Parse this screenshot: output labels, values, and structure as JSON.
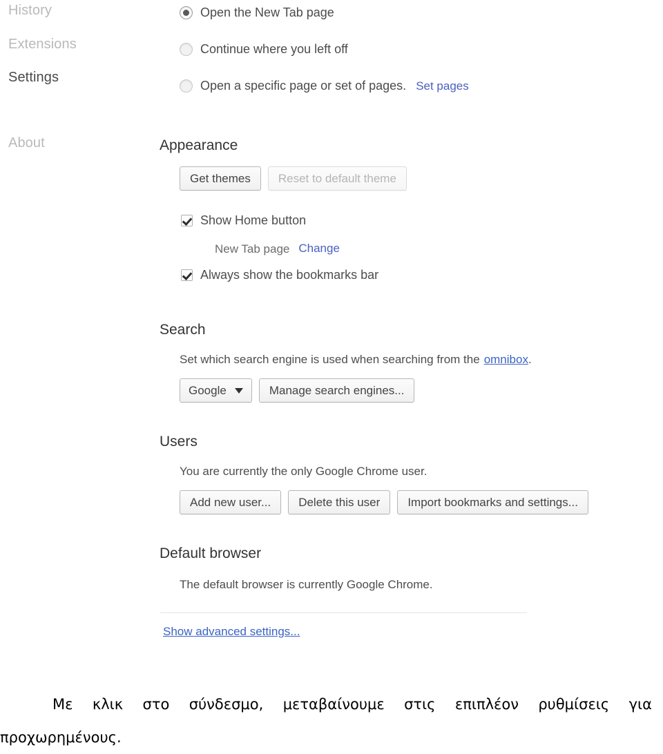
{
  "sidebar": {
    "items": [
      {
        "label": "History",
        "active": false
      },
      {
        "label": "Extensions",
        "active": false
      },
      {
        "label": "Settings",
        "active": true
      },
      {
        "label": "About",
        "active": false
      }
    ]
  },
  "startup": {
    "options": [
      {
        "label": "Open the New Tab page",
        "selected": true
      },
      {
        "label": "Continue where you left off",
        "selected": false
      },
      {
        "label": "Open a specific page or set of pages.",
        "selected": false
      }
    ],
    "set_pages_link": "Set pages"
  },
  "appearance": {
    "title": "Appearance",
    "get_themes_button": "Get themes",
    "reset_theme_button": "Reset to default theme",
    "reset_theme_disabled": true,
    "show_home_button": {
      "label": "Show Home button",
      "checked": true
    },
    "home_page_value": "New Tab page",
    "change_link": "Change",
    "bookmarks_bar": {
      "label": "Always show the bookmarks bar",
      "checked": true
    }
  },
  "search": {
    "title": "Search",
    "description_before": "Set which search engine is used when searching from the",
    "omnibox_link": "omnibox",
    "description_after": ".",
    "engine_selected": "Google",
    "manage_button": "Manage search engines..."
  },
  "users": {
    "title": "Users",
    "status": "You are currently the only Google Chrome user.",
    "add_button": "Add new user...",
    "delete_button": "Delete this user",
    "import_button": "Import bookmarks and settings..."
  },
  "default_browser": {
    "title": "Default browser",
    "status": "The default browser is currently Google Chrome."
  },
  "advanced": {
    "show_advanced_link": "Show advanced settings..."
  },
  "caption": {
    "line1": "Με  κλικ  στο  σύνδεσμο,  μεταβαίνουμε  στις  επιπλέον  ρυθμίσεις  για",
    "line2": "προχωρημένους."
  },
  "colors": {
    "link": "#4a5fc1",
    "link_underlined": "#3b64c4",
    "nav_inactive": "#b9b9b9",
    "nav_active": "#4a4a4a",
    "heading": "#333333",
    "body": "#4d4d4d",
    "button_border": "#b6b6b6",
    "disabled_text": "#b5b5b5",
    "divider": "#e4e4e4"
  }
}
